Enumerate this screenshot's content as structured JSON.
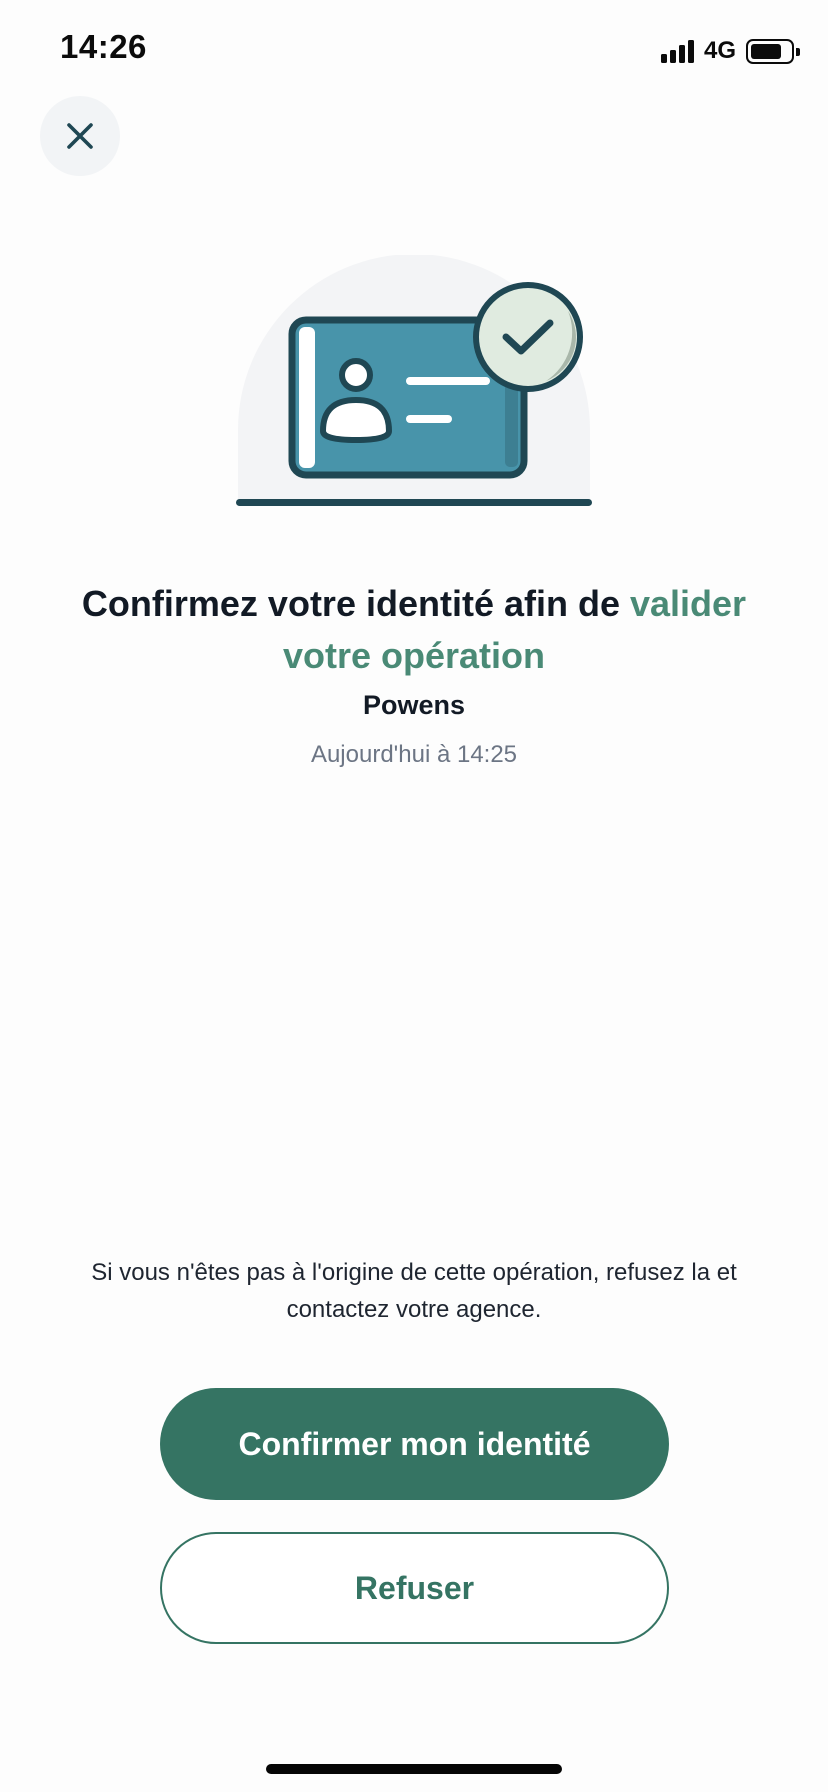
{
  "status_bar": {
    "time": "14:26",
    "network": "4G",
    "battery_level": 0.78,
    "icons": [
      "signal-icon",
      "battery-icon"
    ]
  },
  "close_button": {
    "icon": "close-icon"
  },
  "illustration": {
    "icons": [
      "id-card-icon",
      "checkmark-badge-icon"
    ],
    "colors": {
      "card": "#4894aa",
      "outline": "#1f4753",
      "badge": "#e0ebe0",
      "backdrop": "#f3f4f6"
    }
  },
  "headline": {
    "text": "Confirmez votre identité afin de ",
    "accent": "valider votre opération"
  },
  "merchant": "Powens",
  "datetime": "Aujourd'hui à 14:25",
  "warning": "Si vous n'êtes pas à l'origine de cette opération, refusez la et contactez votre agence.",
  "actions": {
    "confirm_label": "Confirmer mon identité",
    "refuse_label": "Refuser"
  },
  "colors": {
    "accent": "#4a8a76",
    "primary": "#357463",
    "text": "#121a25",
    "muted": "#6c7584"
  }
}
